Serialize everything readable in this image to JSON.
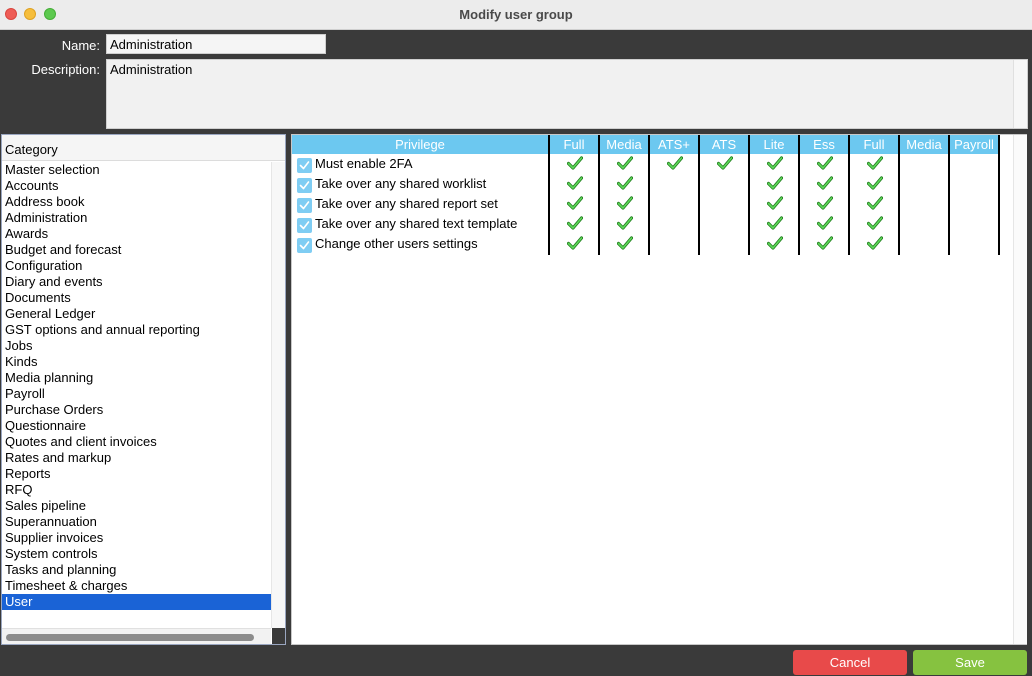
{
  "window": {
    "title": "Modify user group"
  },
  "form": {
    "name_label": "Name:",
    "name_value": "Administration",
    "description_label": "Description:",
    "description_value": "Administration"
  },
  "category": {
    "header": "Category",
    "items": [
      "Master selection",
      "Accounts",
      "Address book",
      "Administration",
      "Awards",
      "Budget and forecast",
      "Configuration",
      "Diary and events",
      "Documents",
      "General Ledger",
      "GST options and annual reporting",
      "Jobs",
      "Kinds",
      "Media planning",
      "Payroll",
      "Purchase Orders",
      "Questionnaire",
      "Quotes and client invoices",
      "Rates and markup",
      "Reports",
      "RFQ",
      "Sales pipeline",
      "Superannuation",
      "Supplier invoices",
      "System controls",
      "Tasks and planning",
      "Timesheet & charges",
      "User"
    ],
    "selected": "User"
  },
  "privileges": {
    "columns": [
      "Privilege",
      "Full",
      "Media",
      "ATS+",
      "ATS",
      "Lite",
      "Ess",
      "Full",
      "Media",
      "Payroll"
    ],
    "rows": [
      {
        "label": "Must enable 2FA",
        "checked": true,
        "levels": [
          true,
          true,
          true,
          true,
          true,
          true,
          true,
          false,
          false
        ]
      },
      {
        "label": "Take over any shared worklist",
        "checked": true,
        "levels": [
          true,
          true,
          false,
          false,
          true,
          true,
          true,
          false,
          false
        ]
      },
      {
        "label": "Take over any shared report set",
        "checked": true,
        "levels": [
          true,
          true,
          false,
          false,
          true,
          true,
          true,
          false,
          false
        ]
      },
      {
        "label": "Take over any shared text template",
        "checked": true,
        "levels": [
          true,
          true,
          false,
          false,
          true,
          true,
          true,
          false,
          false
        ]
      },
      {
        "label": "Change other users settings",
        "checked": true,
        "levels": [
          true,
          true,
          false,
          false,
          true,
          true,
          true,
          false,
          false
        ]
      }
    ]
  },
  "buttons": {
    "cancel": "Cancel",
    "save": "Save"
  },
  "colors": {
    "header_bg": "#6cc8f0",
    "selection": "#1a63d6",
    "cancel": "#e84a4a",
    "save": "#86c240",
    "tick": "#3fbf3a"
  }
}
